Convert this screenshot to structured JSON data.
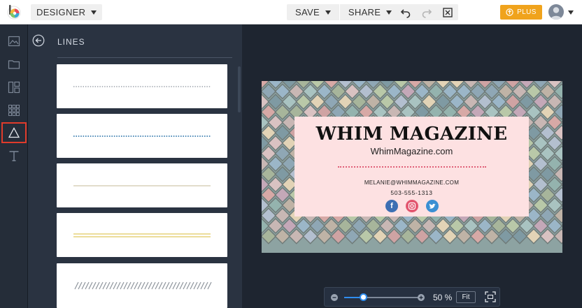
{
  "topbar": {
    "mode_label": "DESIGNER",
    "save_label": "SAVE",
    "share_label": "SHARE",
    "plus_label": "PLUS",
    "accent_plus": "#f0a31c"
  },
  "rail": {
    "items": [
      "image-icon",
      "folder-icon",
      "layout-icon",
      "grid-icon",
      "triangle-icon",
      "text-icon"
    ],
    "active": "triangle-icon",
    "active_color": "#e03b2b"
  },
  "panel": {
    "title": "LINES",
    "thumbnails": [
      "dotted-gray",
      "dotted-blue",
      "solid-beige",
      "double-yellow",
      "hatched-gray"
    ]
  },
  "card": {
    "title": "WHIM MAGAZINE",
    "site": "WhimMagazine.com",
    "email": "MELANIE@WHIMMAGAZINE.COM",
    "phone": "503-555-1313",
    "social": [
      "facebook-icon",
      "instagram-icon",
      "twitter-icon"
    ],
    "social_colors": [
      "#3d6fb3",
      "#e2566f",
      "#3b8fd3"
    ]
  },
  "zoom": {
    "value_label": "50 %",
    "fit_label": "Fit",
    "level": 0.25
  }
}
